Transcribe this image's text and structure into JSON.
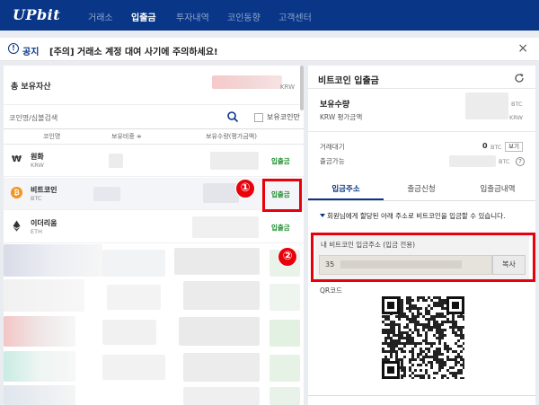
{
  "brand": {
    "logo": "UPbit",
    "nav_color": "#093687",
    "highlight_color": "#e8000b",
    "deposit_color": "#1a8a2a"
  },
  "nav": {
    "items": [
      "거래소",
      "입출금",
      "투자내역",
      "코인동향",
      "고객센터"
    ],
    "active": "입출금"
  },
  "notice": {
    "icon": "!",
    "label": "공지",
    "text": "[주의] 거래소 계정 대여 사기에 주의하세요!",
    "close_icon": "×"
  },
  "assets": {
    "total_label": "총 보유자산",
    "unit": "KRW"
  },
  "search": {
    "placeholder": "코인명/심볼검색",
    "holding_only_label": "보유코인만"
  },
  "columns": {
    "coin": "코인명",
    "ratio": "보유비중 ≑",
    "amount": "보유수량(평가금액)"
  },
  "coins": [
    {
      "name": "원화",
      "symbol": "KRW",
      "icon": "won-icon",
      "action": "입출금"
    },
    {
      "name": "비트코인",
      "symbol": "BTC",
      "icon": "bitcoin-icon",
      "action": "입출금"
    },
    {
      "name": "이더리움",
      "symbol": "ETH",
      "icon": "ethereum-icon",
      "action": "입출금"
    }
  ],
  "annotations": {
    "badge1": "①",
    "badge2": "②"
  },
  "deposit_panel": {
    "title": "비트코인 입출금",
    "holding_label": "보유수량",
    "btc_unit": "BTC",
    "krw_eval_label": "KRW 평가금액",
    "krw_unit": "KRW",
    "pending_label": "거래대기",
    "pending_value": "0",
    "pending_unit": "BTC",
    "view_button": "보기",
    "withdrawable_label": "출금가능",
    "withdrawable_unit": "BTC",
    "help_icon": "?",
    "tabs": [
      "입금주소",
      "출금신청",
      "입출금내역"
    ],
    "active_tab": "입금주소",
    "info_text": "회원님에게 할당된 아래 주소로 비트코인을 입금할 수 있습니다.",
    "address_label": "내 비트코인 입금주소 (입금 전용)",
    "address_value": "35",
    "copy_button": "복사",
    "qr_label": "QR코드"
  }
}
